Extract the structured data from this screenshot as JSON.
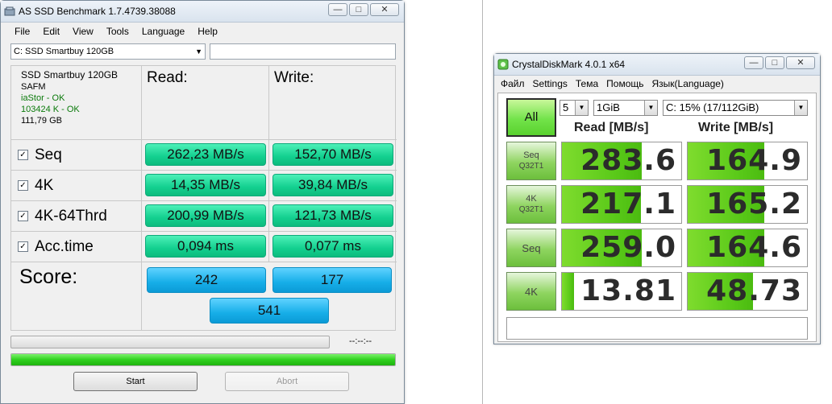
{
  "asssd": {
    "title": "AS SSD Benchmark 1.7.4739.38088",
    "menu": [
      "File",
      "Edit",
      "View",
      "Tools",
      "Language",
      "Help"
    ],
    "drive_select": "C: SSD Smartbuy 120GB",
    "drive_info": {
      "name": "SSD Smartbuy 120GB",
      "fw": "SAFM",
      "driver": "iaStor - OK",
      "align": "103424 K - OK",
      "size": "111,79 GB"
    },
    "read_label": "Read:",
    "write_label": "Write:",
    "rows": [
      {
        "label": "Seq",
        "read": "262,23 MB/s",
        "write": "152,70 MB/s"
      },
      {
        "label": "4K",
        "read": "14,35 MB/s",
        "write": "39,84 MB/s"
      },
      {
        "label": "4K-64Thrd",
        "read": "200,99 MB/s",
        "write": "121,73 MB/s"
      },
      {
        "label": "Acc.time",
        "read": "0,094 ms",
        "write": "0,077 ms"
      }
    ],
    "score_label": "Score:",
    "score_read": "242",
    "score_write": "177",
    "score_total": "541",
    "time_display": "--:--:--",
    "progress_fraction": 1.0,
    "start_label": "Start",
    "abort_label": "Abort",
    "check_glyph": "✓"
  },
  "cdm": {
    "title": "CrystalDiskMark 4.0.1 x64",
    "menu": [
      "Файл",
      "Settings",
      "Тема",
      "Помощь",
      "Язык(Language)"
    ],
    "all_label": "All",
    "count": "5",
    "size": "1GiB",
    "drive": "C: 15% (17/112GiB)",
    "read_header": "Read [MB/s]",
    "write_header": "Write [MB/s]",
    "tests": [
      {
        "line1": "Seq",
        "line2": "Q32T1",
        "read": "283.6",
        "write": "164.9",
        "read_frac": 0.67,
        "write_frac": 0.64
      },
      {
        "line1": "4K",
        "line2": "Q32T1",
        "read": "217.1",
        "write": "165.2",
        "read_frac": 0.66,
        "write_frac": 0.64
      },
      {
        "line1": "Seq",
        "line2": "",
        "read": "259.0",
        "write": "164.6",
        "read_frac": 0.67,
        "write_frac": 0.64
      },
      {
        "line1": "4K",
        "line2": "",
        "read": "13.81",
        "write": "48.73",
        "read_frac": 0.1,
        "write_frac": 0.55
      }
    ]
  }
}
